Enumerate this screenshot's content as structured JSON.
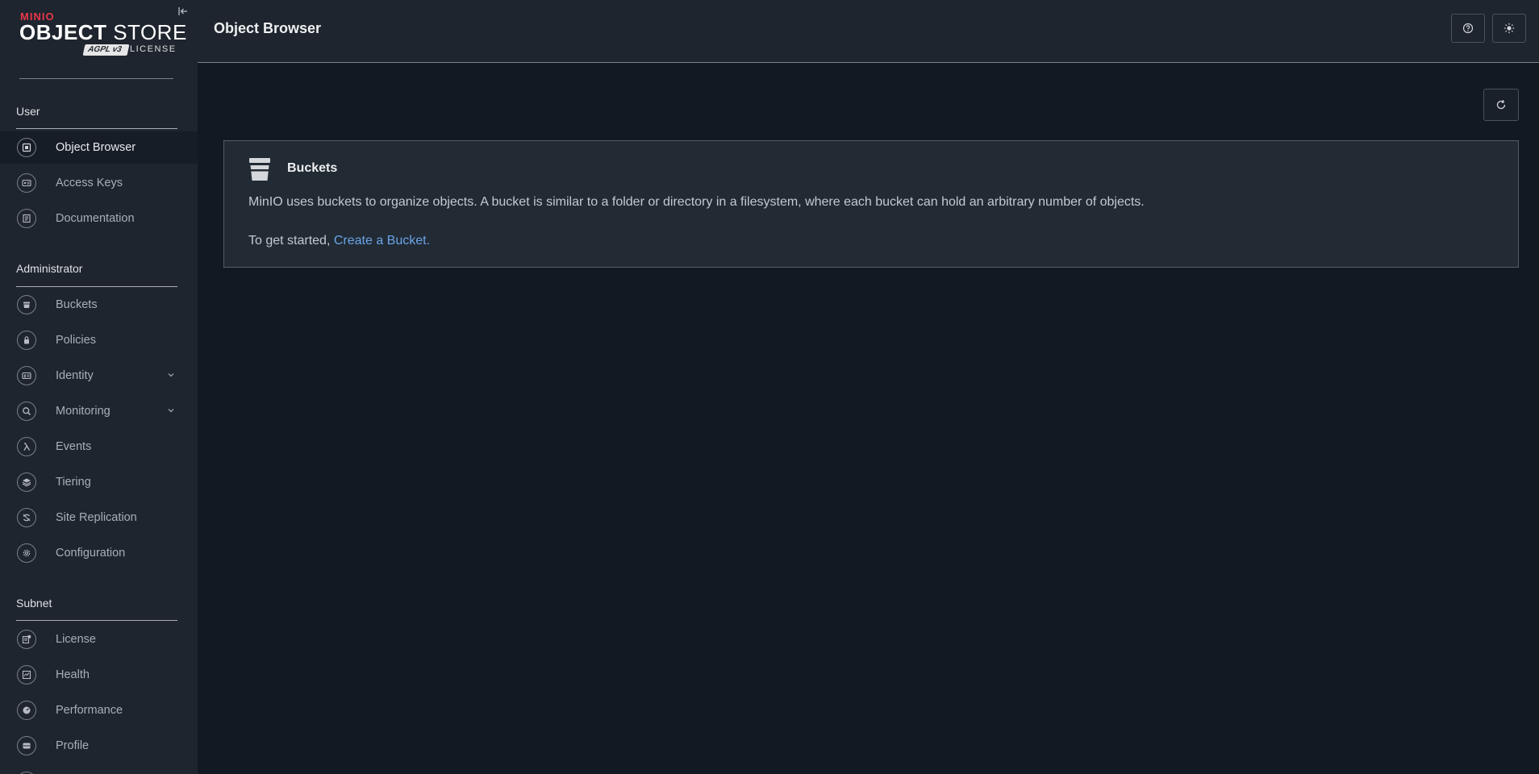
{
  "logo": {
    "brand": "MINIO",
    "product_bold": "OBJECT",
    "product_rest": " STORE",
    "badge": "AGPL v3",
    "license": "LICENSE"
  },
  "header": {
    "title": "Object Browser"
  },
  "sections": {
    "user": "User",
    "administrator": "Administrator",
    "subnet": "Subnet"
  },
  "nav": {
    "object_browser": "Object Browser",
    "access_keys": "Access Keys",
    "documentation": "Documentation",
    "buckets": "Buckets",
    "policies": "Policies",
    "identity": "Identity",
    "monitoring": "Monitoring",
    "events": "Events",
    "tiering": "Tiering",
    "site_replication": "Site Replication",
    "configuration": "Configuration",
    "license": "License",
    "health": "Health",
    "performance": "Performance",
    "profile": "Profile"
  },
  "card": {
    "title": "Buckets",
    "description": "MinIO uses buckets to organize objects. A bucket is similar to a folder or directory in a filesystem, where each bucket can hold an arbitrary number of objects.",
    "start_prefix": "To get started, ",
    "link_text": "Create a Bucket",
    "start_suffix": "."
  },
  "icons": {
    "collapse": "collapse-sidebar-icon",
    "help": "help-icon",
    "theme": "sun-icon",
    "refresh": "refresh-icon"
  },
  "colors": {
    "brand": "#e8374a",
    "link": "#6aa5e8",
    "background": "#131923",
    "sidebar": "#1e252e"
  }
}
